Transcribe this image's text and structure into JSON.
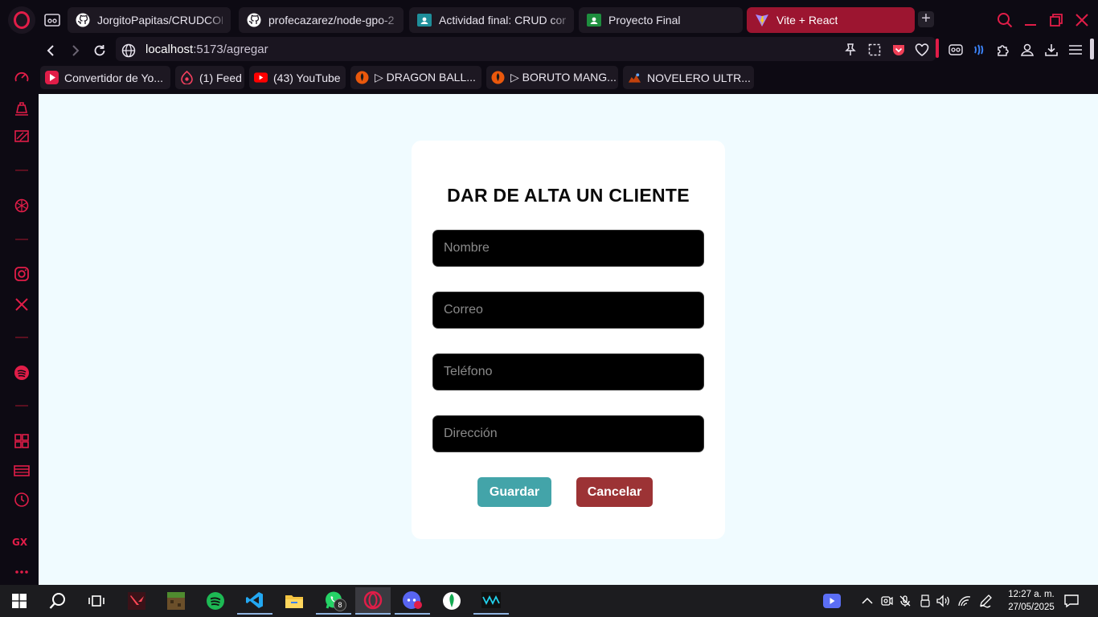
{
  "browser": {
    "tabs": [
      {
        "label": "JorgitoPapitas/CRUDCOM",
        "icon": "github-icon"
      },
      {
        "label": "profecazarez/node-gpo-2",
        "icon": "github-icon"
      },
      {
        "label": "Actividad final: CRUD com",
        "icon": "classroom-icon"
      },
      {
        "label": "Proyecto Final",
        "icon": "classroom-icon"
      },
      {
        "label": "Vite + React",
        "icon": "vite-icon",
        "active": true
      }
    ],
    "url": {
      "host": "localhost",
      "path": ":5173/agregar"
    }
  },
  "bookmarks": [
    {
      "label": "Convertidor de Yo...",
      "icon": "converter-icon"
    },
    {
      "label": "(1) Feed",
      "icon": "feed-icon"
    },
    {
      "label": "(43) YouTube",
      "icon": "youtube-icon"
    },
    {
      "label": "▷ DRAGON BALL...",
      "icon": "manga-icon"
    },
    {
      "label": "▷ BORUTO MANG...",
      "icon": "manga-icon"
    },
    {
      "label": "NOVELERO ULTR...",
      "icon": "novel-icon"
    }
  ],
  "sidebar": {
    "gx_label": "GX"
  },
  "form": {
    "title": "DAR DE ALTA UN CLIENTE",
    "fields": {
      "nombre": {
        "placeholder": "Nombre",
        "value": ""
      },
      "correo": {
        "placeholder": "Correo",
        "value": ""
      },
      "telefono": {
        "placeholder": "Teléfono",
        "value": ""
      },
      "direccion": {
        "placeholder": "Dirección",
        "value": ""
      }
    },
    "save_label": "Guardar",
    "cancel_label": "Cancelar"
  },
  "taskbar": {
    "whatsapp_badge": "8",
    "time": "12:27 a. m.",
    "date": "27/05/2025"
  },
  "colors": {
    "accent": "#e11d48",
    "active_tab": "#9c1530",
    "page_bg": "#f0fbff",
    "save_button": "#43a4a9",
    "cancel_button": "#9c3335"
  }
}
